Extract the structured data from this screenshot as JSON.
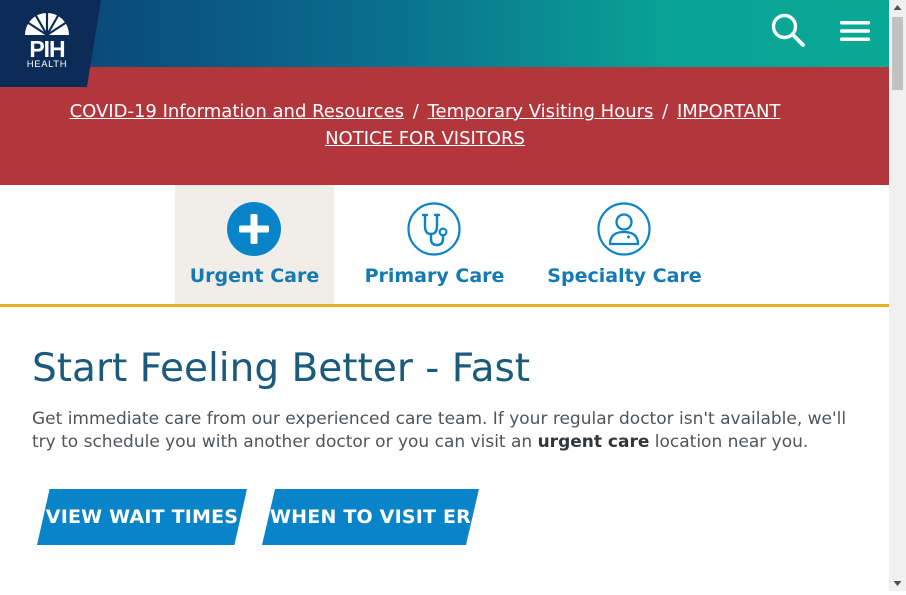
{
  "brand": {
    "logo_text_main": "PIH",
    "logo_text_sub": "HEALTH"
  },
  "header": {
    "search_icon": "search-icon",
    "menu_icon": "hamburger-menu-icon"
  },
  "alert": {
    "links": [
      "COVID-19 Information and Resources",
      "Temporary Visiting Hours",
      "IMPORTANT NOTICE FOR VISITORS"
    ],
    "separator": "/"
  },
  "care_tabs": [
    {
      "label": "Urgent Care",
      "icon": "plus-icon",
      "active": true
    },
    {
      "label": "Primary Care",
      "icon": "stethoscope-icon",
      "active": false
    },
    {
      "label": "Specialty Care",
      "icon": "doctor-icon",
      "active": false
    }
  ],
  "main": {
    "title": "Start Feeling Better - Fast",
    "desc_before": "Get immediate care from our experienced care team. If your regular doctor isn't available, we'll try to schedule you with another doctor or you can visit an ",
    "desc_bold": "urgent care",
    "desc_after": " location near you.",
    "buttons": [
      "VIEW WAIT TIMES",
      "WHEN TO VISIT ER"
    ]
  },
  "colors": {
    "header_gradient_start": "#0b3f72",
    "header_gradient_end": "#0aa995",
    "alert_bg": "#b2373c",
    "accent_blue": "#0a84c9",
    "tab_text": "#137ab5",
    "tab_underline": "#e5b227",
    "title_color": "#1a5a7c"
  }
}
